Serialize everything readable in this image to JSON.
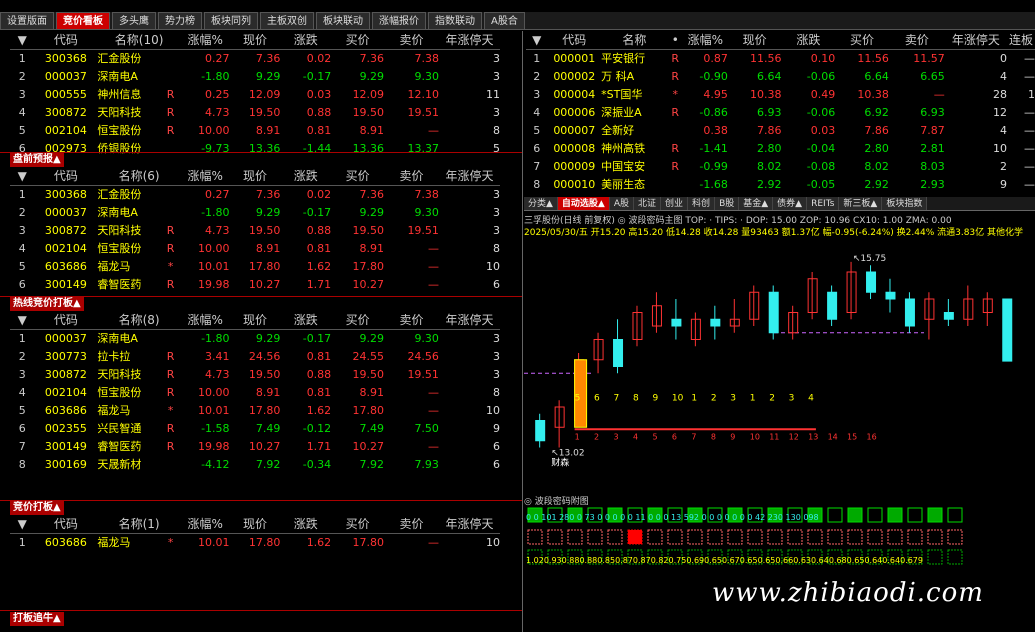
{
  "top_tabs": [
    "设置版面",
    "竞价看板",
    "多头鹰",
    "势力榜",
    "板块同列",
    "主板双创",
    "板块联动",
    "涨幅报价",
    "指数联动",
    "A股合"
  ],
  "active_tab": 1,
  "panel1": {
    "header": [
      "代码",
      "名称(10)",
      "涨幅%",
      "现价",
      "涨跌",
      "买价",
      "卖价",
      "年涨停天"
    ],
    "rows": [
      {
        "idx": "1",
        "code": "300368",
        "name": "汇金股份",
        "tag": "",
        "chg": "0.27",
        "price": "7.36",
        "diff": "0.02",
        "bid": "7.36",
        "ask": "7.38",
        "days": "3",
        "dir": "up"
      },
      {
        "idx": "2",
        "code": "000037",
        "name": "深南电A",
        "tag": "",
        "chg": "-1.80",
        "price": "9.29",
        "diff": "-0.17",
        "bid": "9.29",
        "ask": "9.30",
        "days": "3",
        "dir": "dn"
      },
      {
        "idx": "3",
        "code": "000555",
        "name": "神州信息",
        "tag": "R",
        "chg": "0.25",
        "price": "12.09",
        "diff": "0.03",
        "bid": "12.09",
        "ask": "12.10",
        "days": "11",
        "dir": "up"
      },
      {
        "idx": "4",
        "code": "300872",
        "name": "天阳科技",
        "tag": "R",
        "chg": "4.73",
        "price": "19.50",
        "diff": "0.88",
        "bid": "19.50",
        "ask": "19.51",
        "days": "3",
        "dir": "up"
      },
      {
        "idx": "5",
        "code": "002104",
        "name": "恒宝股份",
        "tag": "R",
        "chg": "10.00",
        "price": "8.91",
        "diff": "0.81",
        "bid": "8.91",
        "ask": "—",
        "days": "8",
        "dir": "up"
      },
      {
        "idx": "6",
        "code": "002973",
        "name": "侨银股份",
        "tag": "",
        "chg": "-9.73",
        "price": "13.36",
        "diff": "-1.44",
        "bid": "13.36",
        "ask": "13.37",
        "days": "5",
        "dir": "dn"
      }
    ]
  },
  "panel2": {
    "title": "盘前预报▲",
    "header": [
      "代码",
      "名称(6)",
      "涨幅%",
      "现价",
      "涨跌",
      "买价",
      "卖价",
      "年涨停天"
    ],
    "rows": [
      {
        "idx": "1",
        "code": "300368",
        "name": "汇金股份",
        "tag": "",
        "chg": "0.27",
        "price": "7.36",
        "diff": "0.02",
        "bid": "7.36",
        "ask": "7.38",
        "days": "3",
        "dir": "up"
      },
      {
        "idx": "2",
        "code": "000037",
        "name": "深南电A",
        "tag": "",
        "chg": "-1.80",
        "price": "9.29",
        "diff": "-0.17",
        "bid": "9.29",
        "ask": "9.30",
        "days": "3",
        "dir": "dn"
      },
      {
        "idx": "3",
        "code": "300872",
        "name": "天阳科技",
        "tag": "R",
        "chg": "4.73",
        "price": "19.50",
        "diff": "0.88",
        "bid": "19.50",
        "ask": "19.51",
        "days": "3",
        "dir": "up"
      },
      {
        "idx": "4",
        "code": "002104",
        "name": "恒宝股份",
        "tag": "R",
        "chg": "10.00",
        "price": "8.91",
        "diff": "0.81",
        "bid": "8.91",
        "ask": "—",
        "days": "8",
        "dir": "up"
      },
      {
        "idx": "5",
        "code": "603686",
        "name": "福龙马",
        "tag": "*",
        "chg": "10.01",
        "price": "17.80",
        "diff": "1.62",
        "bid": "17.80",
        "ask": "—",
        "days": "10",
        "dir": "up"
      },
      {
        "idx": "6",
        "code": "300149",
        "name": "睿智医药",
        "tag": "R",
        "chg": "19.98",
        "price": "10.27",
        "diff": "1.71",
        "bid": "10.27",
        "ask": "—",
        "days": "6",
        "dir": "up"
      }
    ]
  },
  "panel3": {
    "title": "热线竞价打板▲",
    "header": [
      "代码",
      "名称(8)",
      "涨幅%",
      "现价",
      "涨跌",
      "买价",
      "卖价",
      "年涨停天"
    ],
    "rows": [
      {
        "idx": "1",
        "code": "000037",
        "name": "深南电A",
        "tag": "",
        "chg": "-1.80",
        "price": "9.29",
        "diff": "-0.17",
        "bid": "9.29",
        "ask": "9.30",
        "days": "3",
        "dir": "dn"
      },
      {
        "idx": "2",
        "code": "300773",
        "name": "拉卡拉",
        "tag": "R",
        "chg": "3.41",
        "price": "24.56",
        "diff": "0.81",
        "bid": "24.55",
        "ask": "24.56",
        "days": "3",
        "dir": "up"
      },
      {
        "idx": "3",
        "code": "300872",
        "name": "天阳科技",
        "tag": "R",
        "chg": "4.73",
        "price": "19.50",
        "diff": "0.88",
        "bid": "19.50",
        "ask": "19.51",
        "days": "3",
        "dir": "up"
      },
      {
        "idx": "4",
        "code": "002104",
        "name": "恒宝股份",
        "tag": "R",
        "chg": "10.00",
        "price": "8.91",
        "diff": "0.81",
        "bid": "8.91",
        "ask": "—",
        "days": "8",
        "dir": "up"
      },
      {
        "idx": "5",
        "code": "603686",
        "name": "福龙马",
        "tag": "*",
        "chg": "10.01",
        "price": "17.80",
        "diff": "1.62",
        "bid": "17.80",
        "ask": "—",
        "days": "10",
        "dir": "up"
      },
      {
        "idx": "6",
        "code": "002355",
        "name": "兴民智通",
        "tag": "R",
        "chg": "-1.58",
        "price": "7.49",
        "diff": "-0.12",
        "bid": "7.49",
        "ask": "7.50",
        "days": "9",
        "dir": "dn"
      },
      {
        "idx": "7",
        "code": "300149",
        "name": "睿智医药",
        "tag": "R",
        "chg": "19.98",
        "price": "10.27",
        "diff": "1.71",
        "bid": "10.27",
        "ask": "—",
        "days": "6",
        "dir": "up"
      },
      {
        "idx": "8",
        "code": "300169",
        "name": "天晟新材",
        "tag": "",
        "chg": "-4.12",
        "price": "7.92",
        "diff": "-0.34",
        "bid": "7.92",
        "ask": "7.93",
        "days": "6",
        "dir": "dn"
      }
    ]
  },
  "panel4": {
    "title": "竞价打板▲",
    "header": [
      "代码",
      "名称(1)",
      "涨幅%",
      "现价",
      "涨跌",
      "买价",
      "卖价",
      "年涨停天"
    ],
    "rows": [
      {
        "idx": "1",
        "code": "603686",
        "name": "福龙马",
        "tag": "*",
        "chg": "10.01",
        "price": "17.80",
        "diff": "1.62",
        "bid": "17.80",
        "ask": "—",
        "days": "10",
        "dir": "up"
      }
    ]
  },
  "panel5_title": "打板追牛▲",
  "right_table": {
    "header": [
      "代码",
      "名称",
      "•",
      "涨幅%",
      "现价",
      "涨跌",
      "买价",
      "卖价",
      "年涨停天",
      "连板"
    ],
    "rows": [
      {
        "idx": "1",
        "code": "000001",
        "name": "平安银行",
        "tag": "R",
        "chg": "0.87",
        "price": "11.56",
        "diff": "0.10",
        "bid": "11.56",
        "ask": "11.57",
        "days": "0",
        "lb": "—",
        "dir": "up"
      },
      {
        "idx": "2",
        "code": "000002",
        "name": "万 科A",
        "tag": "R",
        "chg": "-0.90",
        "price": "6.64",
        "diff": "-0.06",
        "bid": "6.64",
        "ask": "6.65",
        "days": "4",
        "lb": "—",
        "dir": "dn"
      },
      {
        "idx": "3",
        "code": "000004",
        "name": "*ST国华",
        "tag": "*",
        "chg": "4.95",
        "price": "10.38",
        "diff": "0.49",
        "bid": "10.38",
        "ask": "—",
        "days": "28",
        "lb": "1",
        "dir": "up"
      },
      {
        "idx": "4",
        "code": "000006",
        "name": "深振业A",
        "tag": "R",
        "chg": "-0.86",
        "price": "6.93",
        "diff": "-0.06",
        "bid": "6.92",
        "ask": "6.93",
        "days": "12",
        "lb": "—",
        "dir": "dn"
      },
      {
        "idx": "5",
        "code": "000007",
        "name": "全新好",
        "tag": "",
        "chg": "0.38",
        "price": "7.86",
        "diff": "0.03",
        "bid": "7.86",
        "ask": "7.87",
        "days": "4",
        "lb": "—",
        "dir": "up"
      },
      {
        "idx": "6",
        "code": "000008",
        "name": "神州高铁",
        "tag": "R",
        "chg": "-1.41",
        "price": "2.80",
        "diff": "-0.04",
        "bid": "2.80",
        "ask": "2.81",
        "days": "10",
        "lb": "—",
        "dir": "dn"
      },
      {
        "idx": "7",
        "code": "000009",
        "name": "中国宝安",
        "tag": "R",
        "chg": "-0.99",
        "price": "8.02",
        "diff": "-0.08",
        "bid": "8.02",
        "ask": "8.03",
        "days": "2",
        "lb": "—",
        "dir": "dn"
      },
      {
        "idx": "8",
        "code": "000010",
        "name": "美丽生态",
        "tag": "",
        "chg": "-1.68",
        "price": "2.92",
        "diff": "-0.05",
        "bid": "2.92",
        "ask": "2.93",
        "days": "9",
        "lb": "—",
        "dir": "dn"
      }
    ]
  },
  "chart_tabs": [
    "分类▲",
    "自动选股▲",
    "A股",
    "北证",
    "创业",
    "科创",
    "B股",
    "基金▲",
    "债券▲",
    "REITs",
    "新三板▲",
    "板块指数"
  ],
  "chart_tabs_active": 1,
  "chart_info": {
    "line1": "三孚股份(日线 前复权) ◎ 波段密码主图 TOP: · TIPS: · DOP: 15.00 ZOP: 10.96 CX10: 1.00 ZMA: 0.00",
    "line2": "2025/05/30/五 开15.20 高15.20 低14.28 收14.28 量93463 额1.37亿 幅-0.95(-6.24%) 换2.44% 流通3.83亿 其他化学",
    "high_label": "15.75",
    "low_label": "13.02",
    "buy_label": "财森",
    "sub_title": "◎ 波段密码附图"
  },
  "candles": [
    {
      "o": 13.4,
      "c": 13.1,
      "h": 13.5,
      "l": 13.0
    },
    {
      "o": 13.3,
      "c": 13.6,
      "h": 13.7,
      "l": 13.0
    },
    {
      "o": 13.4,
      "c": 14.3,
      "h": 14.4,
      "l": 13.3
    },
    {
      "o": 14.3,
      "c": 14.6,
      "h": 14.7,
      "l": 14.1
    },
    {
      "o": 14.6,
      "c": 14.2,
      "h": 14.9,
      "l": 14.1
    },
    {
      "o": 14.6,
      "c": 15.0,
      "h": 15.1,
      "l": 14.5
    },
    {
      "o": 14.8,
      "c": 15.1,
      "h": 15.3,
      "l": 14.7
    },
    {
      "o": 14.9,
      "c": 14.8,
      "h": 15.2,
      "l": 14.6
    },
    {
      "o": 14.6,
      "c": 14.9,
      "h": 15.0,
      "l": 14.5
    },
    {
      "o": 14.9,
      "c": 14.8,
      "h": 15.1,
      "l": 14.6
    },
    {
      "o": 14.8,
      "c": 14.9,
      "h": 15.2,
      "l": 14.7
    },
    {
      "o": 14.9,
      "c": 15.3,
      "h": 15.4,
      "l": 14.8
    },
    {
      "o": 15.3,
      "c": 14.7,
      "h": 15.4,
      "l": 14.6
    },
    {
      "o": 14.7,
      "c": 15.0,
      "h": 15.1,
      "l": 14.6
    },
    {
      "o": 15.0,
      "c": 15.5,
      "h": 15.6,
      "l": 14.9
    },
    {
      "o": 15.3,
      "c": 14.9,
      "h": 15.4,
      "l": 14.8
    },
    {
      "o": 15.0,
      "c": 15.6,
      "h": 15.75,
      "l": 14.9
    },
    {
      "o": 15.6,
      "c": 15.3,
      "h": 15.7,
      "l": 15.2
    },
    {
      "o": 15.3,
      "c": 15.2,
      "h": 15.5,
      "l": 15.0
    },
    {
      "o": 15.2,
      "c": 14.8,
      "h": 15.3,
      "l": 14.7
    },
    {
      "o": 14.9,
      "c": 15.2,
      "h": 15.3,
      "l": 14.6
    },
    {
      "o": 15.0,
      "c": 14.9,
      "h": 15.2,
      "l": 14.8
    },
    {
      "o": 14.9,
      "c": 15.2,
      "h": 15.4,
      "l": 14.8
    },
    {
      "o": 15.0,
      "c": 15.2,
      "h": 15.3,
      "l": 14.8
    },
    {
      "o": 15.2,
      "c": 14.28,
      "h": 15.2,
      "l": 14.28
    }
  ],
  "chart_numbers_row1": [
    "5",
    "6",
    "7",
    "8",
    "9",
    "10",
    "1",
    "2",
    "3",
    "1",
    "2",
    "3",
    "4"
  ],
  "chart_numbers_row2": [
    "1",
    "2",
    "3",
    "4",
    "5",
    "6",
    "7",
    "8",
    "9",
    "10",
    "11",
    "12",
    "13",
    "14",
    "15",
    "16"
  ],
  "sub_row1": "0 0 101 280 0 73 0 0 0 0 0 11 0 0 0 13 592 0 0 0 0 0 0 0 42 230 130 098",
  "sub_row3": "1.020.930.880.880.850.870.870.820.750.690.650.670.650.650.660.630.640.680.650.640.640.679",
  "watermark": "www.zhibiaodi.com"
}
